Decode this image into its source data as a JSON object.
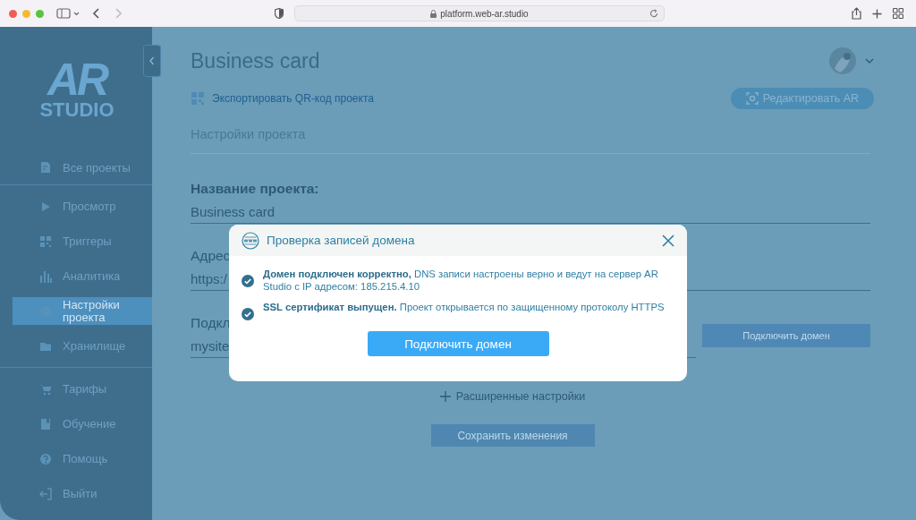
{
  "browser": {
    "url": "platform.web-ar.studio"
  },
  "sidebar": {
    "logo": {
      "mark": "AR",
      "word": "STUDIO"
    },
    "groups": [
      [
        {
          "label": "Все проекты",
          "selected": false
        }
      ],
      [
        {
          "label": "Просмотр",
          "selected": false
        },
        {
          "label": "Триггеры",
          "selected": false
        },
        {
          "label": "Аналитика",
          "selected": false
        },
        {
          "label": "Настройки проекта",
          "selected": true
        },
        {
          "label": "Хранилище",
          "selected": false
        }
      ],
      [
        {
          "label": "Тарифы",
          "selected": false
        },
        {
          "label": "Обучение",
          "selected": false
        },
        {
          "label": "Помощь",
          "selected": false
        },
        {
          "label": "Выйти",
          "selected": false
        }
      ]
    ]
  },
  "page": {
    "title": "Business card",
    "export_link": "Экспортировать QR-код проекта",
    "edit_button": "Редактировать AR",
    "section": "Настройки проекта",
    "name_label": "Название проекта:",
    "name_value": "Business card",
    "address_label": "Адрес",
    "address_value": "https:/",
    "domain_label": "Подкл",
    "domain_value": "mysite",
    "domain_button": "Подключить домен",
    "advanced": "Расширенные настройки",
    "save_button": "Сохранить изменения"
  },
  "dialog": {
    "title": "Проверка записей домена",
    "checks": [
      {
        "text": "**Домен подключен корректно,** DNS записи настроены верно и ведут на сервер AR Studio с IP адресом: 185.215.4.10",
        "checked": true
      },
      {
        "text": "**SSL сертификат выпущен.** Проект открывается по защищенному протоколу HTTPS",
        "checked": true
      }
    ],
    "button": "Подключить домен"
  }
}
